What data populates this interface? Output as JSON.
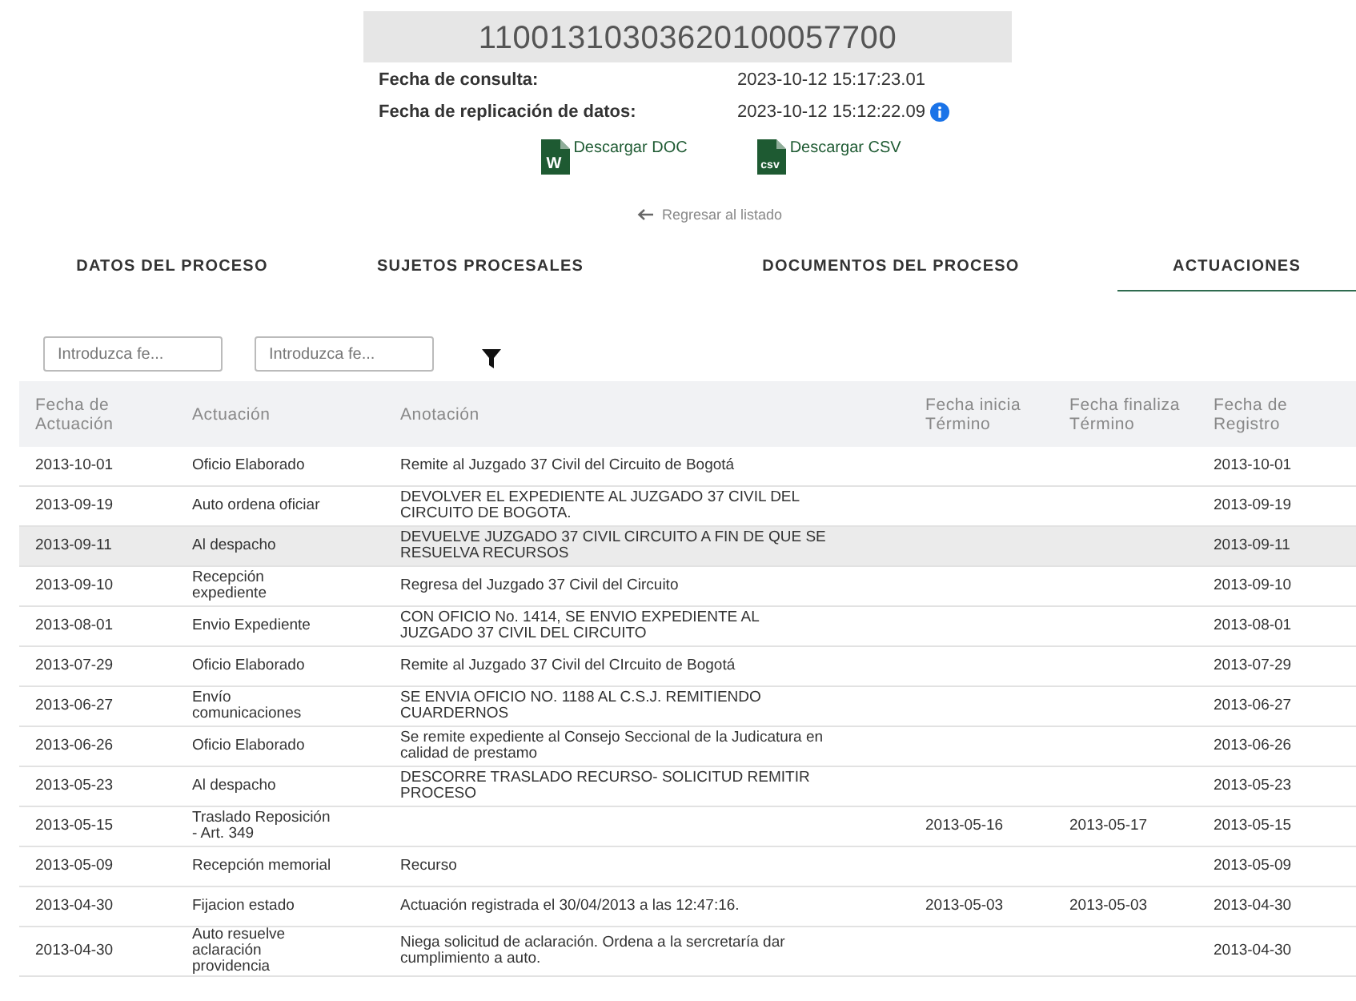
{
  "process_number": "11001310303620100057700",
  "info": [
    {
      "label": "Fecha de consulta:",
      "value": "2023-10-12 15:17:23.01",
      "info_icon": false
    },
    {
      "label": "Fecha de replicación de datos:",
      "value": "2023-10-12 15:12:22.09",
      "info_icon": true
    }
  ],
  "downloads": [
    {
      "kind": "doc",
      "icon_text": "W",
      "label": "Descargar DOC"
    },
    {
      "kind": "csv",
      "icon_text": "csv",
      "label": "Descargar CSV"
    }
  ],
  "back_link": "Regresar al listado",
  "tabs": [
    {
      "label": "DATOS DEL PROCESO",
      "selected": false
    },
    {
      "label": "SUJETOS PROCESALES",
      "selected": false
    },
    {
      "label": "DOCUMENTOS DEL PROCESO",
      "selected": false
    },
    {
      "label": "ACTUACIONES",
      "selected": true
    }
  ],
  "filters": [
    {
      "placeholder": "Introduzca fe..."
    },
    {
      "placeholder": "Introduzca fe..."
    }
  ],
  "table": {
    "columns": [
      "Fecha de Actuación",
      "Actuación",
      "Anotación",
      "Fecha inicia Término",
      "Fecha finaliza Término",
      "Fecha de Registro"
    ],
    "rows": [
      {
        "selected": false,
        "cells": [
          "2013-10-01",
          "Oficio Elaborado",
          "Remite al Juzgado 37 Civil del Circuito de Bogotá",
          "",
          "",
          "2013-10-01"
        ]
      },
      {
        "selected": false,
        "cells": [
          "2013-09-19",
          "Auto ordena oficiar",
          "DEVOLVER EL EXPEDIENTE AL JUZGADO 37 CIVIL DEL CIRCUITO DE BOGOTA.",
          "",
          "",
          "2013-09-19"
        ]
      },
      {
        "selected": true,
        "cells": [
          "2013-09-11",
          "Al despacho",
          "DEVUELVE JUZGADO 37 CIVIL CIRCUITO A FIN DE QUE SE RESUELVA RECURSOS",
          "",
          "",
          "2013-09-11"
        ]
      },
      {
        "selected": false,
        "cells": [
          "2013-09-10",
          "Recepción expediente",
          "Regresa del Juzgado 37 Civil del Circuito",
          "",
          "",
          "2013-09-10"
        ]
      },
      {
        "selected": false,
        "cells": [
          "2013-08-01",
          "Envio Expediente",
          "CON OFICIO No. 1414, SE ENVIO EXPEDIENTE AL JUZGADO 37 CIVIL DEL CIRCUITO",
          "",
          "",
          "2013-08-01"
        ]
      },
      {
        "selected": false,
        "cells": [
          "2013-07-29",
          "Oficio Elaborado",
          "Remite al Juzgado 37 Civil del CIrcuito de Bogotá",
          "",
          "",
          "2013-07-29"
        ]
      },
      {
        "selected": false,
        "cells": [
          "2013-06-27",
          "Envío comunicaciones",
          "SE ENVIA OFICIO NO. 1188 AL C.S.J. REMITIENDO CUARDERNOS",
          "",
          "",
          "2013-06-27"
        ]
      },
      {
        "selected": false,
        "cells": [
          "2013-06-26",
          "Oficio Elaborado",
          "Se remite expediente al Consejo Seccional de la Judicatura en calidad de prestamo",
          "",
          "",
          "2013-06-26"
        ]
      },
      {
        "selected": false,
        "cells": [
          "2013-05-23",
          "Al despacho",
          "DESCORRE TRASLADO RECURSO- SOLICITUD REMITIR PROCESO",
          "",
          "",
          "2013-05-23"
        ]
      },
      {
        "selected": false,
        "cells": [
          "2013-05-15",
          "Traslado Reposición - Art. 349",
          "",
          "2013-05-16",
          "2013-05-17",
          "2013-05-15"
        ]
      },
      {
        "selected": false,
        "cells": [
          "2013-05-09",
          "Recepción memorial",
          "Recurso",
          "",
          "",
          "2013-05-09"
        ]
      },
      {
        "selected": false,
        "cells": [
          "2013-04-30",
          "Fijacion estado",
          "Actuación registrada el 30/04/2013 a las 12:47:16.",
          "2013-05-03",
          "2013-05-03",
          "2013-04-30"
        ]
      },
      {
        "selected": false,
        "cells": [
          "2013-04-30",
          "Auto resuelve aclaración providencia",
          "Niega solicitud de aclaración. Ordena a la sercretaría dar cumplimiento a auto.",
          "",
          "",
          "2013-04-30"
        ]
      }
    ]
  }
}
